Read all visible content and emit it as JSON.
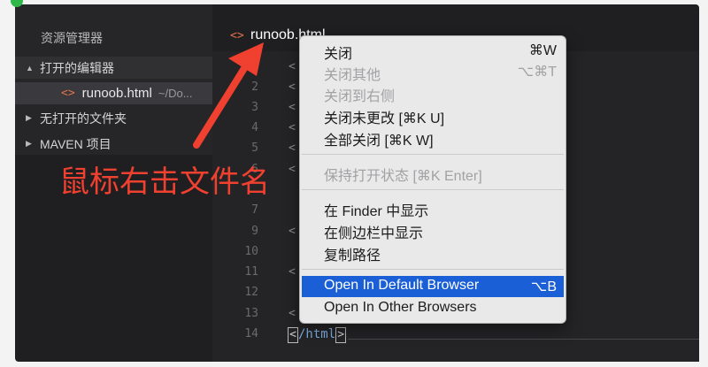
{
  "sidebar": {
    "title": "资源管理器",
    "open_editors": {
      "toggle": "▲",
      "label": "打开的编辑器"
    },
    "open_file": {
      "icon": "<>",
      "name": "runoob.html",
      "path": "~/Do..."
    },
    "no_folder": {
      "toggle": "▶",
      "label": "无打开的文件夹"
    },
    "maven": {
      "toggle": "▶",
      "label": "MAVEN 项目"
    }
  },
  "tab": {
    "icon": "<>",
    "label": "runoob.html"
  },
  "editor": {
    "line_numbers": [
      "2",
      "3",
      "4",
      "5",
      "6",
      "7",
      "9",
      "10",
      "11",
      "12",
      "13",
      "14"
    ],
    "code_lines": [
      "<",
      "<",
      "<",
      "<",
      "<",
      "<",
      "<",
      "<",
      "<"
    ],
    "last_line": {
      "open": "<",
      "text": "/html",
      "close": ">"
    }
  },
  "annotation": {
    "text": "鼠标右击文件名",
    "color": "#f0402f"
  },
  "context_menu": {
    "items": [
      {
        "label": "关闭",
        "shortcut": "⌘W"
      },
      {
        "label": "关闭其他",
        "shortcut": "⌥⌘T"
      },
      {
        "label": "关闭到右侧",
        "shortcut": ""
      },
      {
        "label": "关闭未更改 [⌘K U]",
        "shortcut": ""
      },
      {
        "label": "全部关闭 [⌘K W]",
        "shortcut": ""
      },
      {
        "label": "保持打开状态 [⌘K Enter]",
        "shortcut": ""
      },
      {
        "label": "在 Finder 中显示",
        "shortcut": ""
      },
      {
        "label": "在侧边栏中显示",
        "shortcut": ""
      },
      {
        "label": "复制路径",
        "shortcut": ""
      },
      {
        "label": "Open In Default Browser",
        "shortcut": "⌥B"
      },
      {
        "label": "Open In Other Browsers",
        "shortcut": ""
      }
    ],
    "highlight_color": "#1b5fd6"
  },
  "colors": {
    "accent_orange": "#e0724a",
    "window_bg": "#1f1f21"
  }
}
